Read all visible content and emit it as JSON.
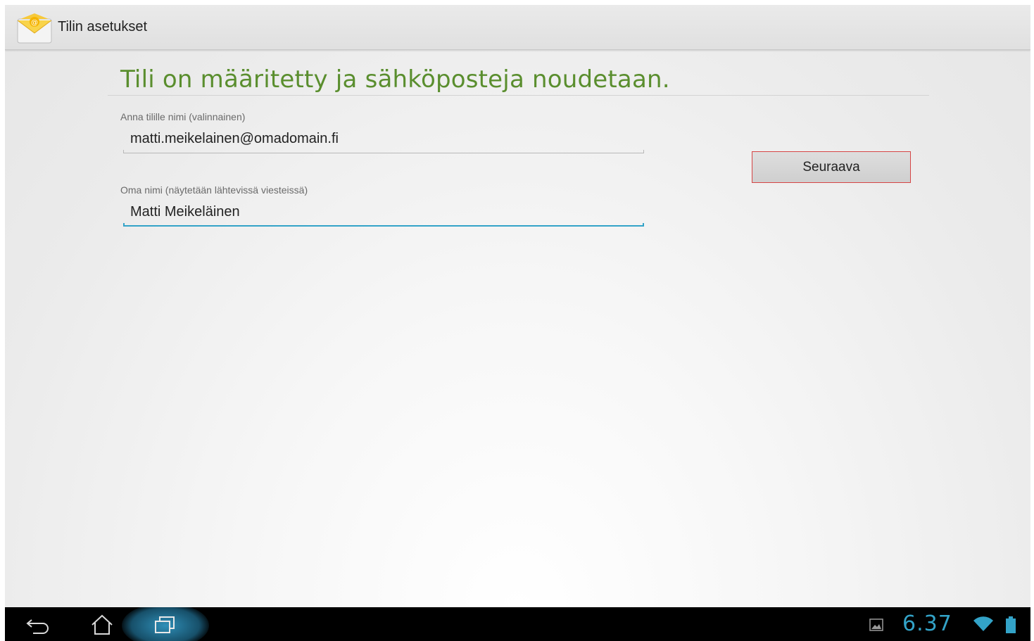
{
  "header": {
    "title": "Tilin asetukset",
    "icon": "email-app-icon"
  },
  "main": {
    "heading": "Tili on määritetty ja sähköposteja noudetaan.",
    "account_name": {
      "label": "Anna tilille nimi (valinnainen)",
      "value": "matti.meikelainen@omadomain.fi"
    },
    "your_name": {
      "label": "Oma nimi (näytetään lähtevissä viesteissä)",
      "value": "Matti Meikeläinen"
    },
    "next_button": "Seuraava"
  },
  "navbar": {
    "buttons": [
      "back-icon",
      "home-icon",
      "recent-apps-icon"
    ],
    "clock": "6.37",
    "status_icons": [
      "gallery-notification-icon",
      "wifi-icon",
      "battery-icon"
    ]
  },
  "colors": {
    "heading": "#5a8e2e",
    "focus_accent": "#33a3c8",
    "button_highlight_border": "#d64545"
  }
}
